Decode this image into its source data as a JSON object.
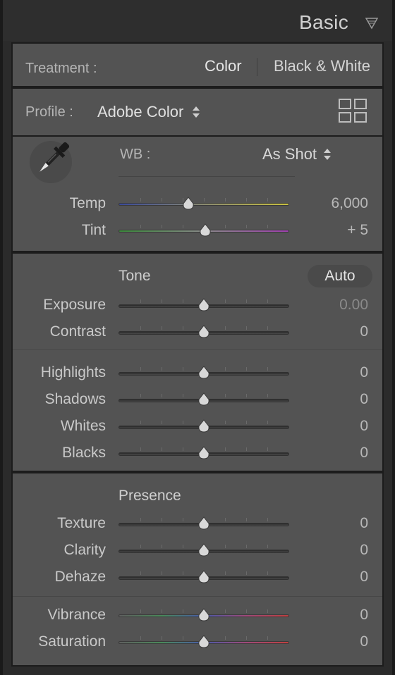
{
  "header": {
    "title": "Basic"
  },
  "treatment": {
    "label": "Treatment :",
    "color_label": "Color",
    "bw_label": "Black & White"
  },
  "profile": {
    "label": "Profile :",
    "value": "Adobe Color"
  },
  "wb": {
    "label": "WB :",
    "value": "As Shot",
    "sliders": [
      {
        "label": "Temp",
        "value": "6,000",
        "position": 0.41,
        "track": "temp"
      },
      {
        "label": "Tint",
        "value": "+ 5",
        "position": 0.51,
        "track": "tint"
      }
    ]
  },
  "tone": {
    "title": "Tone",
    "auto_label": "Auto",
    "group1": [
      {
        "label": "Exposure",
        "value": "0.00",
        "position": 0.5,
        "dim": true
      },
      {
        "label": "Contrast",
        "value": "0",
        "position": 0.5
      }
    ],
    "group2": [
      {
        "label": "Highlights",
        "value": "0",
        "position": 0.5
      },
      {
        "label": "Shadows",
        "value": "0",
        "position": 0.5
      },
      {
        "label": "Whites",
        "value": "0",
        "position": 0.5
      },
      {
        "label": "Blacks",
        "value": "0",
        "position": 0.5
      }
    ]
  },
  "presence": {
    "title": "Presence",
    "group1": [
      {
        "label": "Texture",
        "value": "0",
        "position": 0.5
      },
      {
        "label": "Clarity",
        "value": "0",
        "position": 0.5
      },
      {
        "label": "Dehaze",
        "value": "0",
        "position": 0.5
      }
    ],
    "group2": [
      {
        "label": "Vibrance",
        "value": "0",
        "position": 0.5,
        "track": "color"
      },
      {
        "label": "Saturation",
        "value": "0",
        "position": 0.5,
        "track": "color"
      }
    ]
  },
  "colors": {
    "panel_bg": "#535353",
    "temp_gradient": [
      "#3a4a9a",
      "#8a8a70",
      "#c8c040"
    ],
    "tint_gradient": [
      "#3a8a3a",
      "#8a8a8a",
      "#a040b0"
    ],
    "color_gradient": [
      "#606060",
      "#4a8a5a",
      "#4a5aaa",
      "#a04a7a",
      "#c04040"
    ]
  },
  "icons": {
    "collapse": "collapse-triangle-icon",
    "grid": "grid-browse-icon",
    "dropper": "eyedropper-icon",
    "spinner": "up-down-spinner-icon"
  }
}
